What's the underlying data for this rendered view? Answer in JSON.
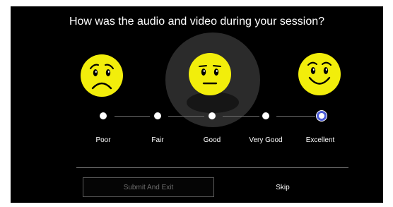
{
  "dialog": {
    "question": "How was the audio and video during your session?"
  },
  "ratings": {
    "options": [
      {
        "label": "Poor",
        "selected": false
      },
      {
        "label": "Fair",
        "selected": false
      },
      {
        "label": "Good",
        "selected": false
      },
      {
        "label": "Very Good",
        "selected": false
      },
      {
        "label": "Excellent",
        "selected": true
      }
    ],
    "faces": [
      {
        "icon": "sad-face-icon",
        "for": "Poor"
      },
      {
        "icon": "neutral-face-icon",
        "for": "Good"
      },
      {
        "icon": "happy-face-icon",
        "for": "Excellent"
      }
    ]
  },
  "actions": {
    "submit_label": "Submit And Exit",
    "skip_label": "Skip"
  },
  "colors": {
    "background": "#000000",
    "face_yellow": "#f2ee0b",
    "selected_ring": "#4b5bd6",
    "disabled_text": "#6d6d6d"
  }
}
